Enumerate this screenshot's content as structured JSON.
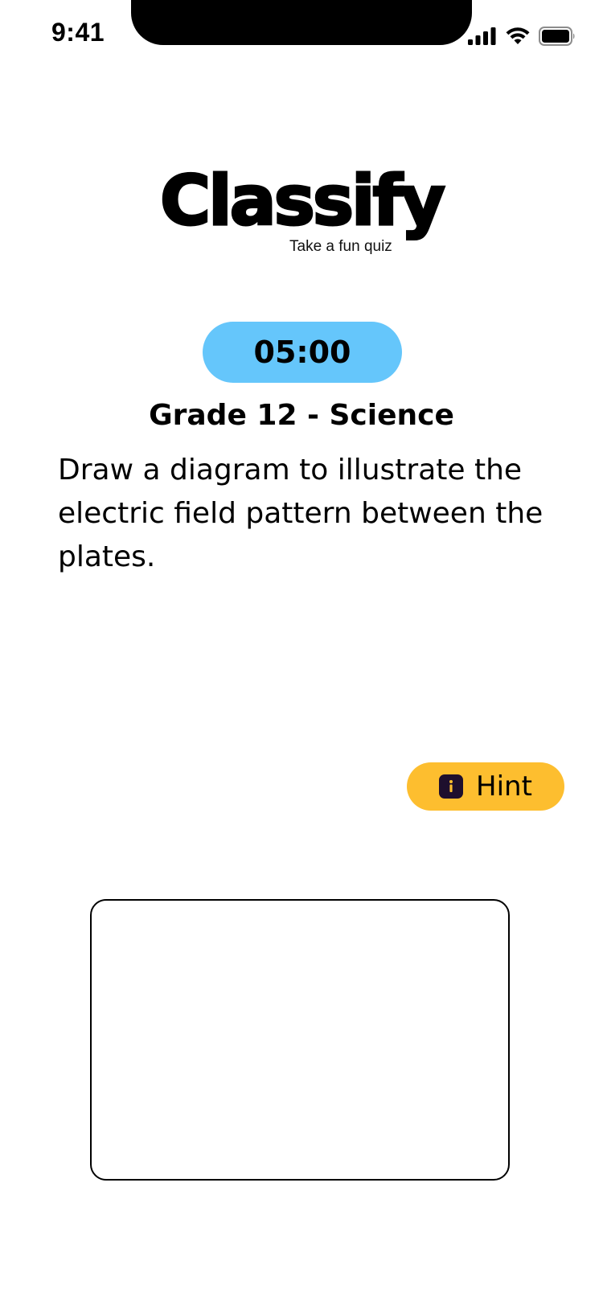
{
  "status_bar": {
    "time": "9:41",
    "icons": [
      "cellular-signal-icon",
      "wifi-icon",
      "battery-icon"
    ]
  },
  "logo": {
    "title": "Classify",
    "tagline": "Take a fun quiz"
  },
  "timer": {
    "value": "05:00",
    "color": "#65c6fb"
  },
  "quiz": {
    "subject": "Grade 12 - Science",
    "question": "Draw a diagram to illustrate the electric field pattern between the plates."
  },
  "hint_button": {
    "icon": "info-icon",
    "icon_glyph": "i",
    "label": "Hint",
    "color": "#fdbe2f"
  },
  "drawing_area": {
    "content": ""
  }
}
